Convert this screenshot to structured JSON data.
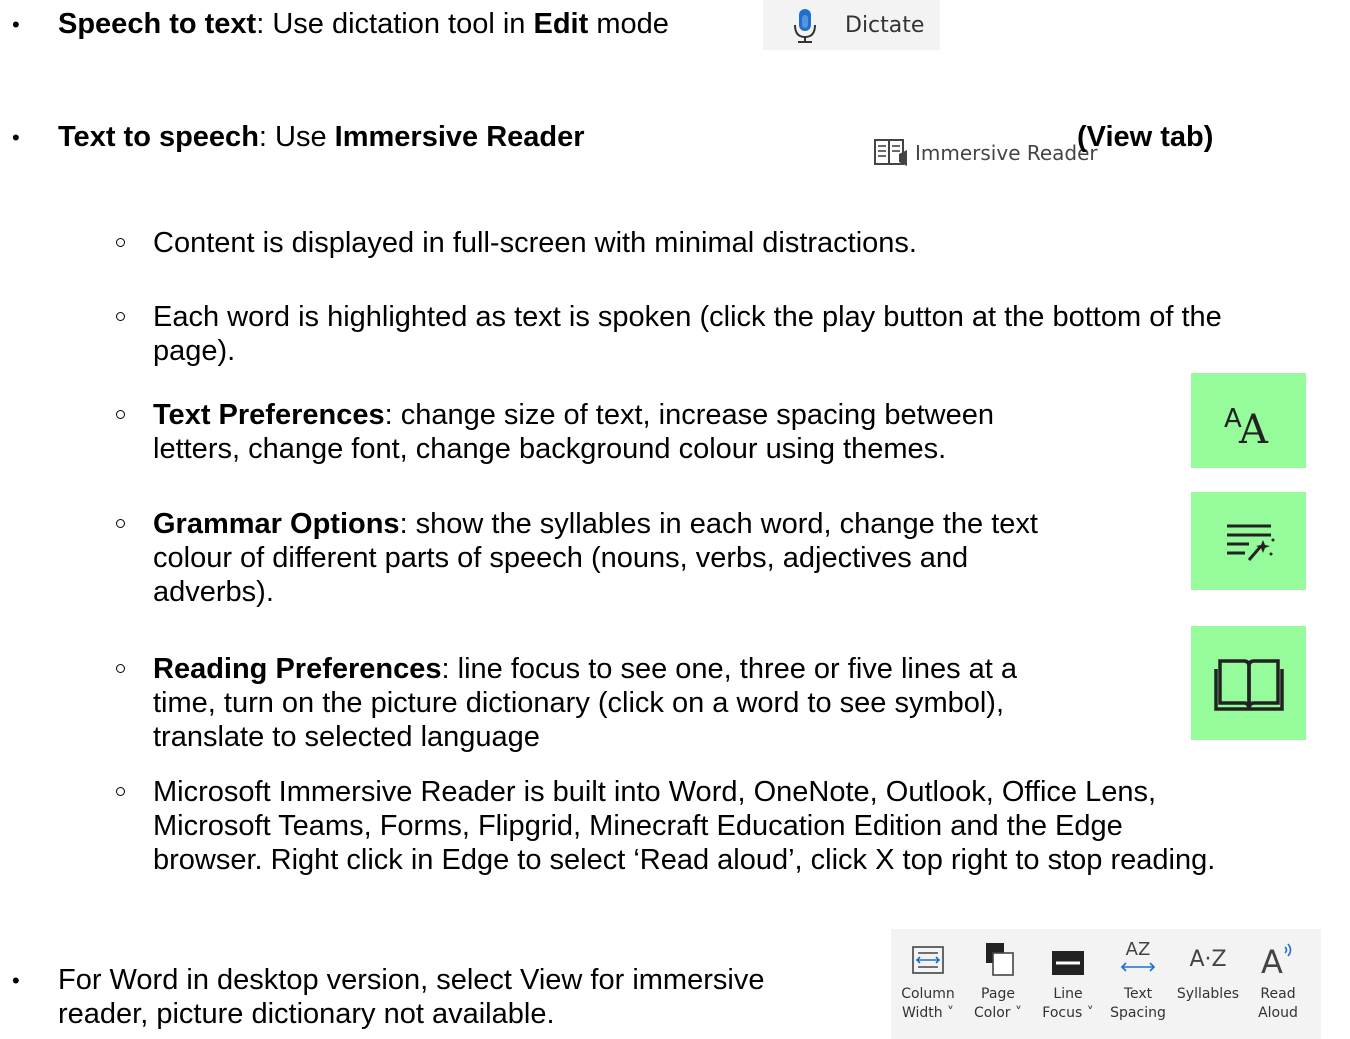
{
  "bullets": {
    "b1": {
      "bold_a": "Speech to text",
      "text_a": ": Use dictation tool in ",
      "bold_b": "Edit",
      "text_b": " mode"
    },
    "b2": {
      "bold_a": "Text to speech",
      "text_a": ": Use ",
      "bold_b": "Immersive Reader",
      "view_tab": "(View tab)"
    },
    "b3": {
      "text_line1": "For Word in desktop version, select View for immersive",
      "text_line2": "reader, picture dictionary not available."
    }
  },
  "dictate_button": {
    "label": "Dictate",
    "icon": "microphone-icon"
  },
  "immersive_reader_button": {
    "label": "Immersive Reader",
    "icon": "immersive-reader-icon"
  },
  "sub": {
    "s1": "Content is displayed in full-screen with minimal distractions.",
    "s2_line1": "Each word is highlighted as text is spoken (click the play button at the bottom of the",
    "s2_line2": "page).",
    "s3": {
      "bold": "Text Preferences",
      "line1": ": change size of text, increase spacing between",
      "line2": "letters, change font, change background colour using themes."
    },
    "s4": {
      "bold": "Grammar Options",
      "line1": ": show the syllables in each word, change the text",
      "line2": "colour of different parts of speech (nouns, verbs, adjectives and",
      "line3": "adverbs)."
    },
    "s5": {
      "bold": "Reading Preferences",
      "line1": ": line focus to see one, three or five lines at a",
      "line2": "time, turn on the picture dictionary (click on a word to see symbol),",
      "line3": "translate to selected language"
    },
    "s6_line1": "Microsoft Immersive Reader is built into Word, OneNote, Outlook, Office Lens,",
    "s6_line2": "Microsoft Teams, Forms, Flipgrid, Minecraft Education Edition and the Edge",
    "s6_line3": "browser.  Right click in Edge to select ‘Read aloud’, click X top right to stop reading."
  },
  "icons": {
    "accent": "#96fb9a",
    "text_prefs": "text-size-icon",
    "grammar": "grammar-options-icon",
    "reading": "book-icon"
  },
  "ribbon": {
    "column": {
      "l1": "Column",
      "l2": "Width ˅"
    },
    "page": {
      "l1": "Page",
      "l2": "Color ˅"
    },
    "line": {
      "l1": "Line",
      "l2": "Focus ˅"
    },
    "text": {
      "l1": "Text",
      "l2": "Spacing",
      "glyph": "AZ"
    },
    "syl": {
      "l1": "Syllables",
      "glyph": "A·Z"
    },
    "read": {
      "l1": "Read",
      "l2": "Aloud"
    }
  }
}
